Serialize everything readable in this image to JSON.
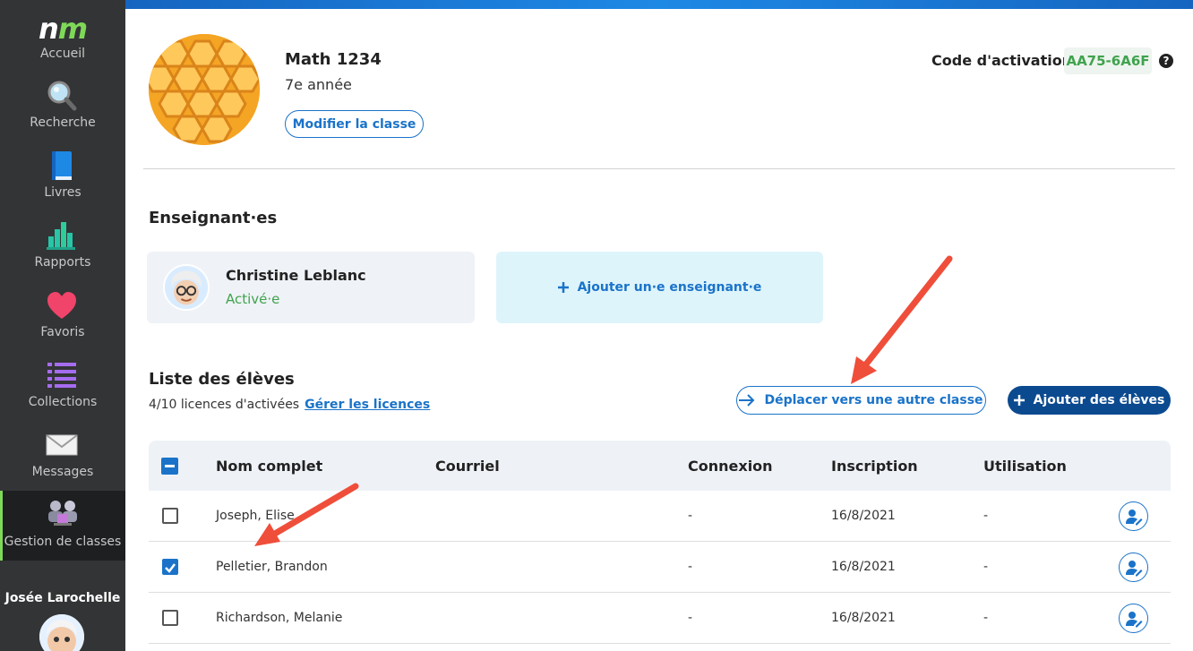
{
  "sidebar": {
    "logo": {
      "n": "n",
      "m": "m"
    },
    "items": [
      {
        "label": "Accueil",
        "icon": "home-logo"
      },
      {
        "label": "Recherche",
        "icon": "magnifier-icon"
      },
      {
        "label": "Livres",
        "icon": "book-icon"
      },
      {
        "label": "Rapports",
        "icon": "bar-chart-icon"
      },
      {
        "label": "Favoris",
        "icon": "heart-icon"
      },
      {
        "label": "Collections",
        "icon": "list-icon"
      },
      {
        "label": "Messages",
        "icon": "envelope-icon"
      },
      {
        "label": "Gestion de classes",
        "icon": "class-management-icon",
        "active": true
      }
    ],
    "user_name": "Josée Larochelle"
  },
  "class_header": {
    "name": "Math 1234",
    "grade": "7e année",
    "edit_button": "Modifier la classe",
    "activation_label": "Code d'activation",
    "activation_code": "AA75-6A6F",
    "help": "?"
  },
  "teachers": {
    "title": "Enseignant·es",
    "list": [
      {
        "name": "Christine Leblanc",
        "status": "Activé·e"
      }
    ],
    "add_label": "Ajouter un·e enseignant·e"
  },
  "students": {
    "title": "Liste des élèves",
    "licences_text": "4/10 licences d'activées",
    "manage_link": "Gérer les licences",
    "move_button": "Déplacer vers une autre classe",
    "add_button": "Ajouter des élèves",
    "columns": [
      "Nom complet",
      "Courriel",
      "Connexion",
      "Inscription",
      "Utilisation"
    ],
    "rows": [
      {
        "name": "Joseph, Elise",
        "email": "",
        "connexion": "-",
        "inscription": "16/8/2021",
        "utilisation": "-",
        "checked": false
      },
      {
        "name": "Pelletier, Brandon",
        "email": "",
        "connexion": "-",
        "inscription": "16/8/2021",
        "utilisation": "-",
        "checked": true
      },
      {
        "name": "Richardson, Melanie",
        "email": "",
        "connexion": "-",
        "inscription": "16/8/2021",
        "utilisation": "-",
        "checked": false
      }
    ]
  },
  "colors": {
    "accent_blue": "#1a73c9",
    "dark_blue": "#0b4a8f",
    "green": "#3fa34d",
    "sidebar_bg": "#333436",
    "annotation_arrow": "#ef4e3a"
  }
}
